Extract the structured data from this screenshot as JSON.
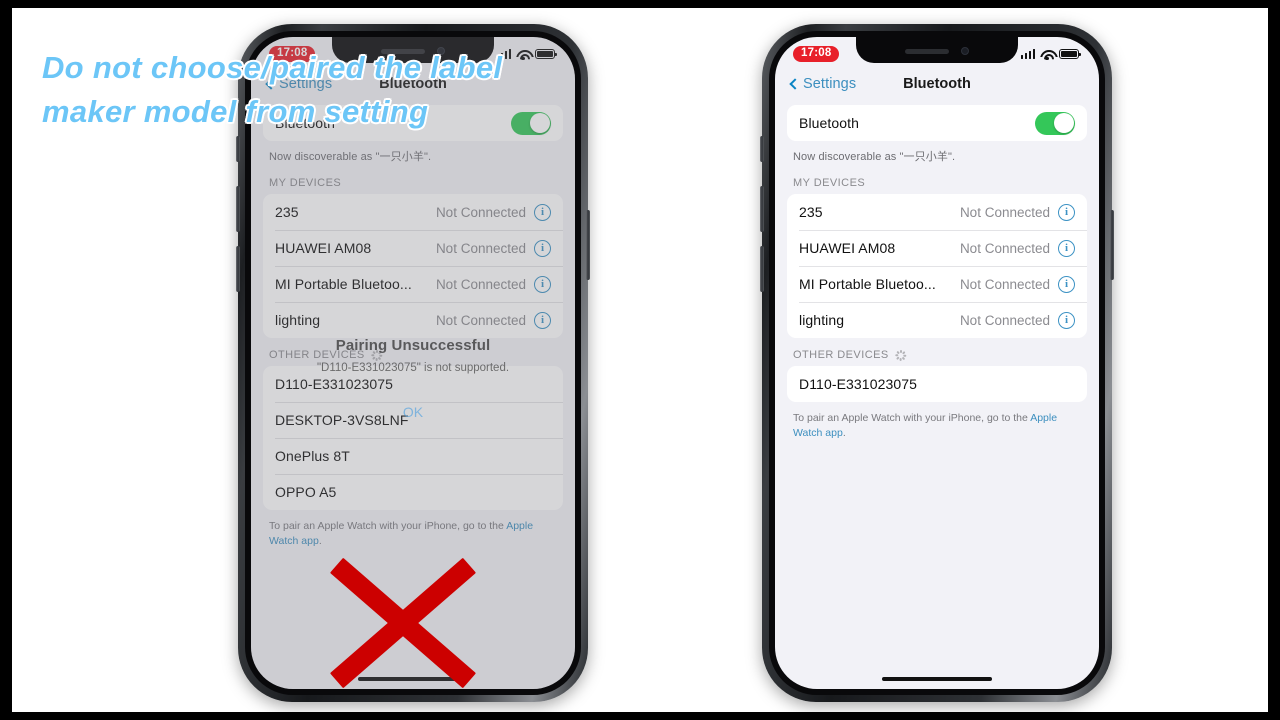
{
  "overlay": {
    "caption": "Do not choose/paired the label\nmaker model from setting",
    "caption_color": "#6cc6f7",
    "x_mark_color": "#cc0000",
    "x_mark_name": "red-x-mark"
  },
  "phones": {
    "left": {
      "status_bar": {
        "time": "17:08",
        "signal": "signal-bars",
        "wifi": "wifi-icon",
        "battery": "battery-icon"
      },
      "nav": {
        "back_label": "Settings",
        "title": "Bluetooth"
      },
      "bluetooth_row": {
        "label": "Bluetooth",
        "toggle_state": "on",
        "toggle_color": "#34c759"
      },
      "discoverable_note": "Now discoverable as \"一只小羊\".",
      "my_devices_header": "MY DEVICES",
      "my_devices": [
        {
          "name": "235",
          "status": "Not Connected"
        },
        {
          "name": "HUAWEI AM08",
          "status": "Not Connected"
        },
        {
          "name": "MI Portable Bluetoo...",
          "status": "Not Connected"
        },
        {
          "name": "lighting",
          "status": "Not Connected"
        }
      ],
      "other_devices_header": "OTHER DEVICES",
      "other_devices": [
        {
          "name": "D110-E331023075"
        },
        {
          "name": "DESKTOP-3VS8LNF"
        },
        {
          "name": "OnePlus 8T"
        },
        {
          "name": "OPPO A5"
        }
      ],
      "footnote_text": "To pair an Apple Watch with your iPhone, go to the ",
      "footnote_link": "Apple Watch app",
      "footnote_end": ".",
      "alert": {
        "title": "Pairing Unsuccessful",
        "message": "\"D110-E331023075\" is not supported.",
        "ok_label": "OK"
      }
    },
    "right": {
      "status_bar": {
        "time": "17:08",
        "signal": "signal-bars",
        "wifi": "wifi-icon",
        "battery": "battery-icon"
      },
      "nav": {
        "back_label": "Settings",
        "title": "Bluetooth"
      },
      "bluetooth_row": {
        "label": "Bluetooth",
        "toggle_state": "on",
        "toggle_color": "#34c759"
      },
      "discoverable_note": "Now discoverable as \"一只小羊\".",
      "my_devices_header": "MY DEVICES",
      "my_devices": [
        {
          "name": "235",
          "status": "Not Connected"
        },
        {
          "name": "HUAWEI AM08",
          "status": "Not Connected"
        },
        {
          "name": "MI Portable Bluetoo...",
          "status": "Not Connected"
        },
        {
          "name": "lighting",
          "status": "Not Connected"
        }
      ],
      "other_devices_header": "OTHER DEVICES",
      "other_devices": [
        {
          "name": "D110-E331023075"
        }
      ],
      "footnote_text": "To pair an Apple Watch with your iPhone, go to the ",
      "footnote_link": "Apple Watch app",
      "footnote_end": "."
    }
  }
}
